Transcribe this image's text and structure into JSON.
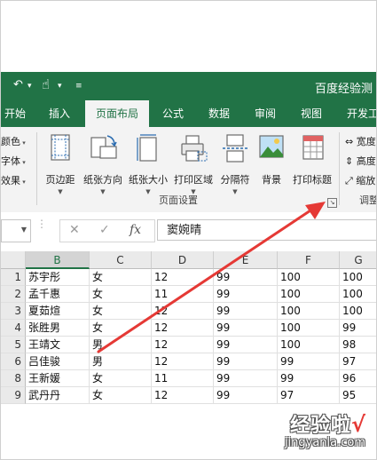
{
  "window": {
    "title": "百度经验测"
  },
  "tabs": [
    {
      "label": "开始"
    },
    {
      "label": "插入"
    },
    {
      "label": "页面布局"
    },
    {
      "label": "公式"
    },
    {
      "label": "数据"
    },
    {
      "label": "审阅"
    },
    {
      "label": "视图"
    },
    {
      "label": "开发工"
    }
  ],
  "ribbon": {
    "left_commands": [
      "颜色",
      "字体",
      "效果"
    ],
    "buttons": [
      {
        "label": "页边距"
      },
      {
        "label": "纸张方向"
      },
      {
        "label": "纸张大小"
      },
      {
        "label": "打印区域"
      },
      {
        "label": "分隔符"
      },
      {
        "label": "背景"
      },
      {
        "label": "打印标题"
      }
    ],
    "group_label": "页面设置",
    "launcher": "↘",
    "right_commands": [
      "宽度",
      "高度",
      "缩放"
    ],
    "right_group_label": "调整"
  },
  "formula_bar": {
    "cancel": "✕",
    "enter": "✓",
    "fx": "fx",
    "value": "窦婉晴"
  },
  "grid": {
    "columns": [
      "B",
      "C",
      "D",
      "E",
      "F",
      "G"
    ],
    "rows": [
      {
        "no": "1",
        "name": "苏宇彤",
        "gender": "女",
        "d": "12",
        "e": "99",
        "f": "100",
        "g": "100"
      },
      {
        "no": "2",
        "name": "孟千惠",
        "gender": "女",
        "d": "11",
        "e": "99",
        "f": "100",
        "g": "100"
      },
      {
        "no": "3",
        "name": "夏茹煊",
        "gender": "女",
        "d": "12",
        "e": "99",
        "f": "100",
        "g": "100"
      },
      {
        "no": "4",
        "name": "张胜男",
        "gender": "女",
        "d": "12",
        "e": "99",
        "f": "100",
        "g": "99"
      },
      {
        "no": "5",
        "name": "王靖文",
        "gender": "男",
        "d": "12",
        "e": "99",
        "f": "100",
        "g": "98"
      },
      {
        "no": "6",
        "name": "吕佳骏",
        "gender": "男",
        "d": "12",
        "e": "99",
        "f": "99",
        "g": "97"
      },
      {
        "no": "8",
        "name": "王新媛",
        "gender": "女",
        "d": "11",
        "e": "99",
        "f": "99",
        "g": "96"
      },
      {
        "no": "9",
        "name": "武丹丹",
        "gender": "女",
        "d": "12",
        "e": "99",
        "f": "97",
        "g": "95"
      }
    ]
  },
  "watermark": {
    "main": "经验啦",
    "check": "√",
    "url": "jingyanla.com"
  },
  "colors": {
    "excel_green": "#217346",
    "arrow_red": "#e53935"
  }
}
